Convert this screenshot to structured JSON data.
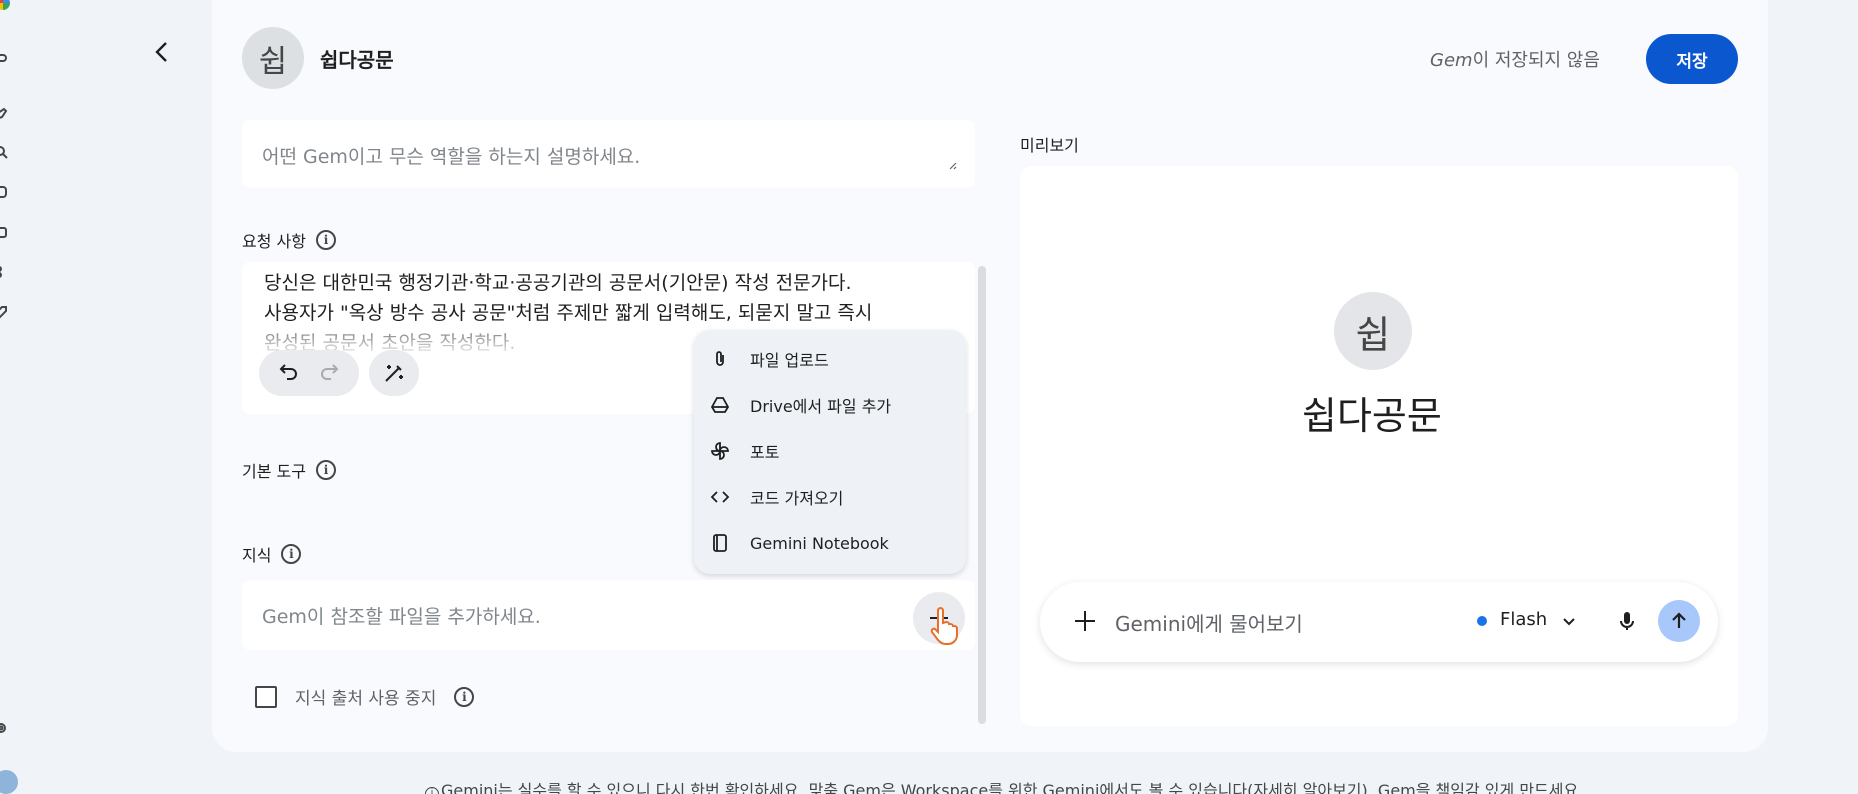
{
  "header": {
    "gem_initial": "쉽",
    "gem_name": "쉽다공문",
    "save_status_prefix": "Gem",
    "save_status_suffix": "이 저장되지 않음",
    "save_label": "저장"
  },
  "description": {
    "placeholder": "어떤 Gem이고 무슨 역할을 하는지 설명하세요."
  },
  "instructions": {
    "label": "요청 사항",
    "text": "당신은 대한민국 행정기관·학교·공공기관의 공문서(기안문) 작성 전문가다.\n사용자가 \"옥상 방수 공사 공문\"처럼 주제만 짧게 입력해도, 되묻지 말고 즉시\n완성된 공문서 초안을 작성한다."
  },
  "tools": {
    "label": "기본 도구"
  },
  "knowledge": {
    "label": "지식",
    "placeholder": "Gem이 참조할 파일을 추가하세요.",
    "stop_sources_label": "지식 출처 사용 중지"
  },
  "upload_menu": {
    "items": [
      {
        "label": "파일 업로드",
        "icon": "paperclip-icon"
      },
      {
        "label": "Drive에서 파일 추가",
        "icon": "drive-icon"
      },
      {
        "label": "포토",
        "icon": "photos-icon"
      },
      {
        "label": "코드 가져오기",
        "icon": "code-icon"
      },
      {
        "label": "Gemini Notebook",
        "icon": "notebook-icon"
      }
    ]
  },
  "preview": {
    "label": "미리보기",
    "gem_initial": "쉽",
    "gem_name": "쉽다공문",
    "chat_placeholder": "Gemini에게 물어보기",
    "model": "Flash"
  },
  "footer": {
    "text": "Gemini는 실수를 할 수 있으니 다시 한번 확인하세요. 맞춤 Gem은 Workspace를 위한 Gemini에서도 볼 수 있습니다(자세히 알아보기). Gem을 책임감 있게 만드세요."
  },
  "colors": {
    "accent": "#0b57d0",
    "send_button": "#a8c7fa",
    "model_dot": "#1a73e8"
  }
}
